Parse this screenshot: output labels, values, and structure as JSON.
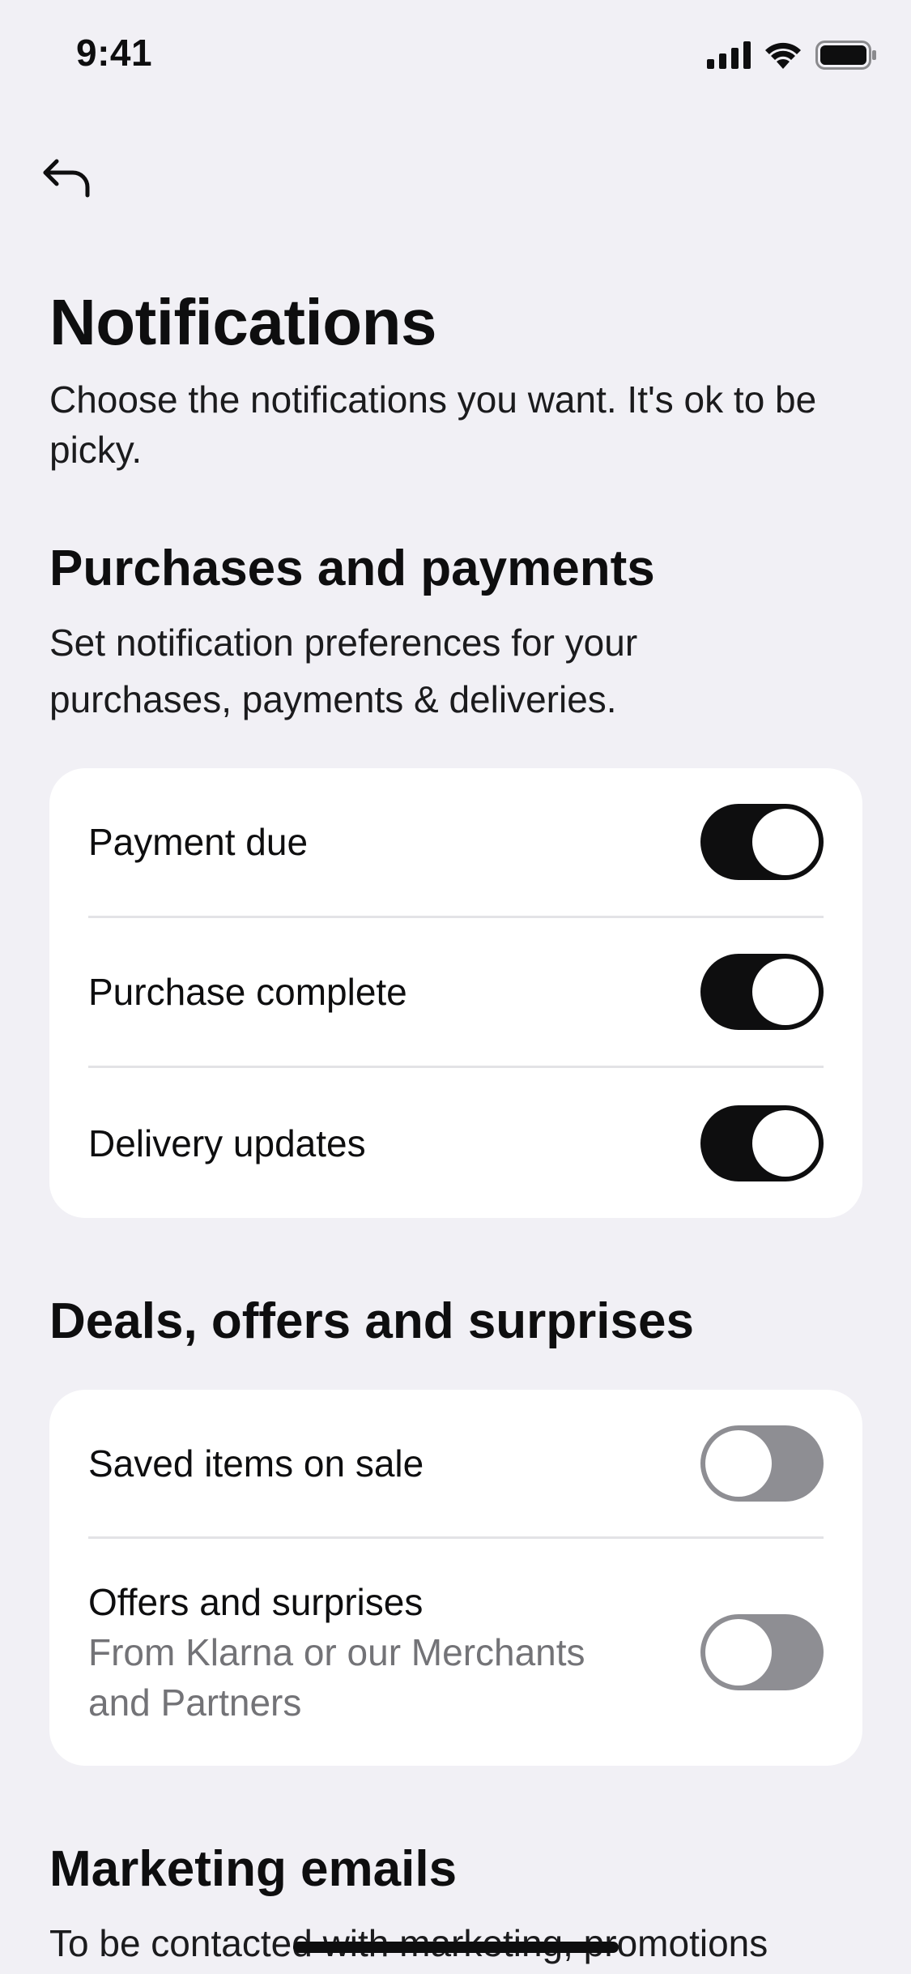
{
  "status_bar": {
    "time": "9:41",
    "icons": [
      "cellular-signal-icon",
      "wifi-icon",
      "battery-icon"
    ]
  },
  "nav": {
    "back_icon": "back-arrow-icon"
  },
  "page": {
    "title": "Notifications",
    "subtitle": "Choose the notifications you want. It's ok to be picky."
  },
  "sections": {
    "purchases": {
      "title": "Purchases and payments",
      "description": "Set notification preferences for your purchases, payments & deliveries.",
      "items": [
        {
          "label": "Payment due",
          "on": true
        },
        {
          "label": "Purchase complete",
          "on": true
        },
        {
          "label": "Delivery updates",
          "on": true
        }
      ]
    },
    "deals": {
      "title": "Deals, offers and surprises",
      "items": [
        {
          "label": "Saved items on sale",
          "on": false
        },
        {
          "label": "Offers and surprises",
          "sublabel": "From Klarna or our Merchants and Partners",
          "on": false
        }
      ]
    },
    "marketing": {
      "title": "Marketing emails",
      "description": "To be contacted with marketing, promotions"
    }
  },
  "colors": {
    "background": "#f1f0f5",
    "toggle_on": "#0e0e0f",
    "toggle_off": "#8e8e93",
    "card": "#ffffff"
  }
}
